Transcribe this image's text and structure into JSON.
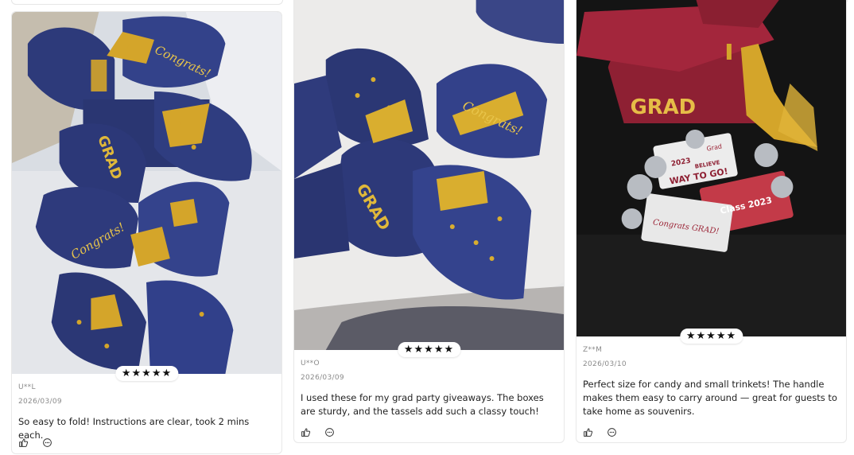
{
  "reviews": [
    {
      "user": "U**L",
      "date": "2026/03/09",
      "rating_stars": "★★★★★",
      "rating": 5,
      "text": "So easy to fold! Instructions are clear, took 2 mins each.",
      "photo_text": {
        "congrats": "Congrats!",
        "grad": "GRAD"
      }
    },
    {
      "user": "U**O",
      "date": "2026/03/09",
      "rating_stars": "★★★★★",
      "rating": 5,
      "text": "I used these for my grad party giveaways. The boxes are sturdy, and the tassels add such a classy touch!",
      "photo_text": {
        "congrats": "Congrats!",
        "grad": "GRAD"
      }
    },
    {
      "user": "Z**M",
      "date": "2026/03/10",
      "rating_stars": "★★★★★",
      "rating": 5,
      "text": "Perfect size for candy and small trinkets! The handle makes them easy to carry around — great for guests to take home as souvenirs.",
      "photo_text": {
        "grad": "GRAD",
        "year": "2023",
        "congrats": "Congrats GRAD!",
        "way_to_go": "WAY TO GO!",
        "believe": "BELIEVE",
        "class": "Class 2023",
        "grad_small": "Grad"
      }
    }
  ],
  "icons": {
    "like": "thumbs-up-icon",
    "comment": "comment-icon"
  },
  "colors": {
    "navy": "#2d3a7a",
    "gold": "#d4a52a",
    "maroon": "#9b2335",
    "star": "#111111"
  }
}
